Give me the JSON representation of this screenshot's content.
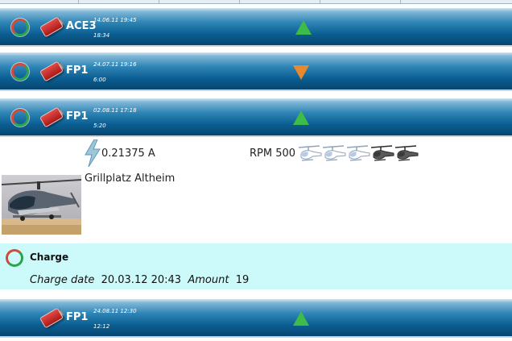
{
  "entries": [
    {
      "name": "ACE3",
      "date": "14.06.11 19:45",
      "duration": "18:34",
      "trend": "up"
    },
    {
      "name": "FP1",
      "date": "24.07.11 19:16",
      "duration": "6:00",
      "trend": "down"
    },
    {
      "name": "FP1",
      "date": "02.08.11 17:18",
      "duration": "5:20",
      "trend": "up"
    },
    {
      "name": "FP1",
      "date": "24.08.11 12:30",
      "duration": "12:12",
      "trend": "up"
    }
  ],
  "details": {
    "current": "0.21375 A",
    "rpm_label": "RPM 500",
    "location": "Grillplatz Altheim",
    "heli_rating": 2,
    "heli_max": 5
  },
  "charge": {
    "title": "Charge",
    "date_label": "Charge date",
    "date_value": "20.03.12 20:43",
    "amount_label": "Amount",
    "amount_value": "19"
  },
  "colors": {
    "band_dark": "#06466f",
    "band_light": "#2f86b6",
    "trend_up": "#3fbb4a",
    "trend_down": "#e8882f",
    "charge_bg": "#ccfafa"
  }
}
